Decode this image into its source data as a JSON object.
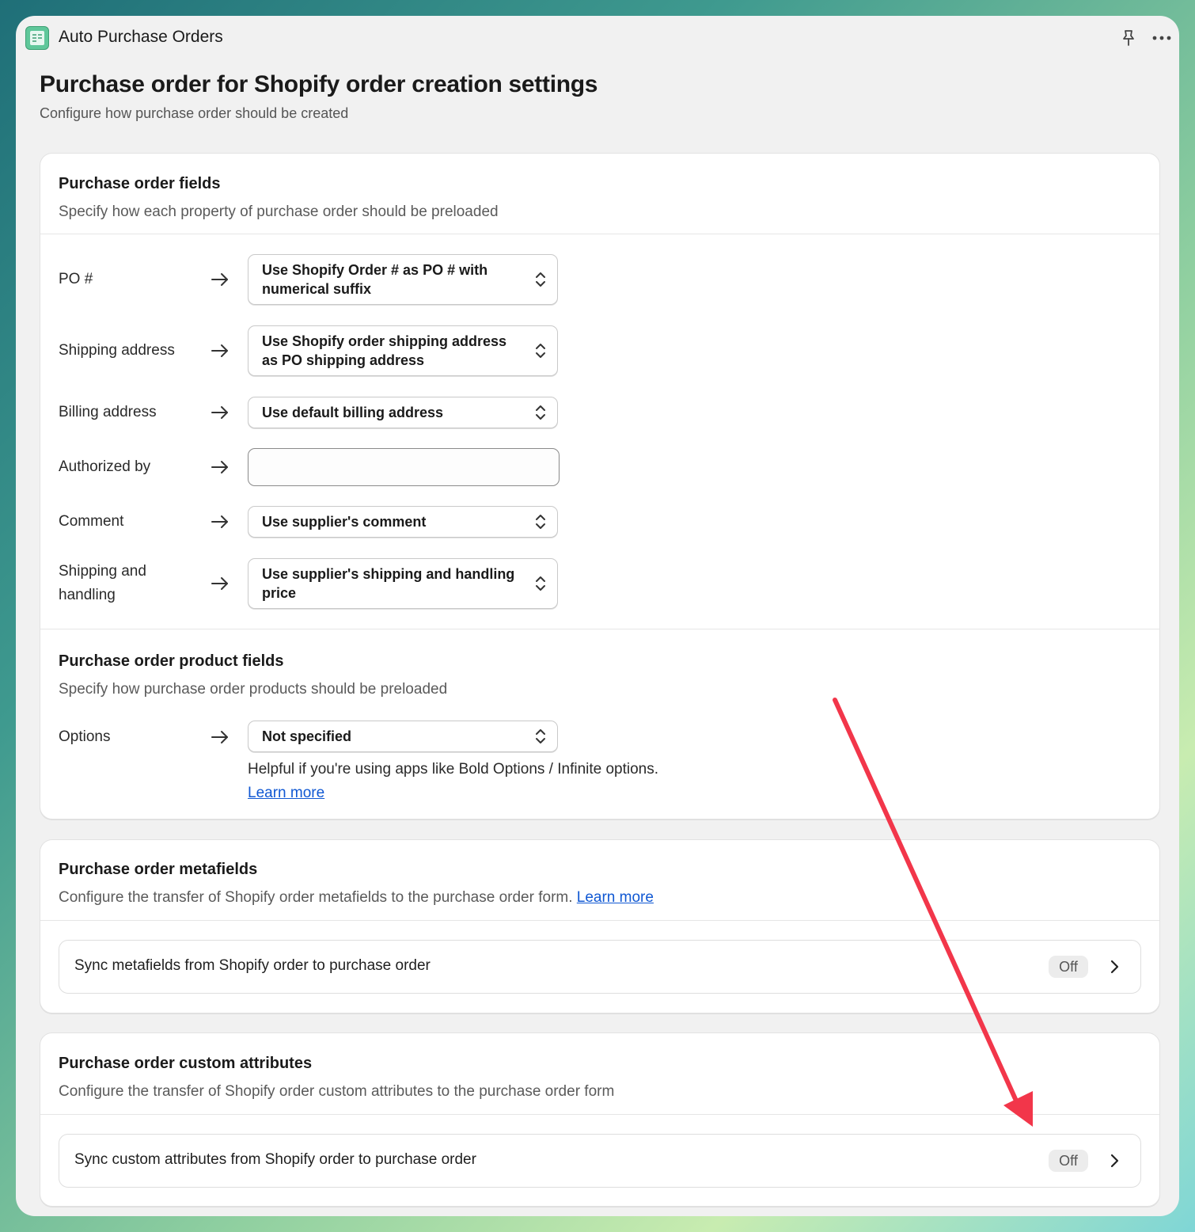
{
  "app": {
    "title": "Auto Purchase Orders"
  },
  "page": {
    "title": "Purchase order for Shopify order creation settings",
    "subtitle": "Configure how purchase order should be created"
  },
  "po_fields": {
    "title": "Purchase order fields",
    "subtitle": "Specify how each property of purchase order should be preloaded",
    "rows": [
      {
        "label": "PO #",
        "value": "Use Shopify Order # as PO # with numerical suffix"
      },
      {
        "label": "Shipping address",
        "value": "Use Shopify order shipping address as PO shipping address"
      },
      {
        "label": "Billing address",
        "value": "Use default billing address"
      },
      {
        "label": "Authorized by",
        "value": ""
      },
      {
        "label": "Comment",
        "value": "Use supplier's comment"
      },
      {
        "label": "Shipping and handling",
        "value": "Use supplier's shipping and handling price"
      }
    ]
  },
  "product_fields": {
    "title": "Purchase order product fields",
    "subtitle": "Specify how purchase order products should be preloaded",
    "options_label": "Options",
    "options_value": "Not specified",
    "help": "Helpful if you're using apps like Bold Options / Infinite options.",
    "learn_more": "Learn more"
  },
  "metafields": {
    "title": "Purchase order metafields",
    "subtitle": "Configure the transfer of Shopify order metafields to the purchase order form.",
    "learn_more": "Learn more",
    "sync_label": "Sync metafields from Shopify order to purchase order",
    "status": "Off"
  },
  "custom_attributes": {
    "title": "Purchase order custom attributes",
    "subtitle": "Configure the transfer of Shopify order custom attributes to the purchase order form",
    "sync_label": "Sync custom attributes from Shopify order to purchase order",
    "status": "Off"
  },
  "colors": {
    "link": "#1058d3",
    "annotation_arrow": "#f2364a",
    "app_icon": "#5fc79a"
  }
}
